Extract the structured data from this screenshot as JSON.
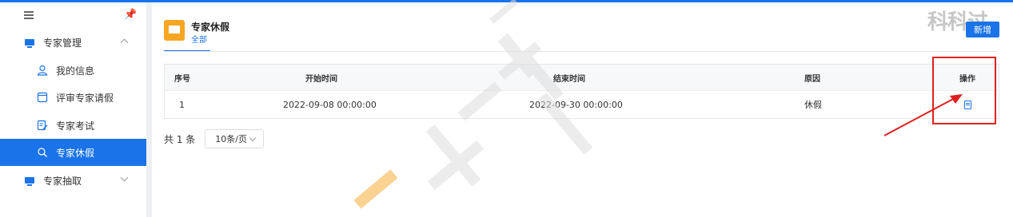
{
  "sidebar": {
    "items": [
      {
        "label": "专家管理",
        "icon": "monitor-icon",
        "expanded": true
      },
      {
        "label": "我的信息",
        "icon": "user-icon"
      },
      {
        "label": "评审专家请假",
        "icon": "window-icon"
      },
      {
        "label": "专家考试",
        "icon": "edit-document-icon"
      },
      {
        "label": "专家休假",
        "icon": "search-user-icon",
        "active": true
      },
      {
        "label": "专家抽取",
        "icon": "monitor-icon",
        "expanded": false
      }
    ]
  },
  "header": {
    "title": "专家休假",
    "subtitle": "全部",
    "new_button": "新增",
    "watermark": "科科过"
  },
  "table": {
    "columns": [
      "序号",
      "开始时间",
      "结束时间",
      "原因",
      "操作"
    ],
    "rows": [
      {
        "index": "1",
        "start": "2022-09-08 00:00:00",
        "end": "2022-09-30 00:00:00",
        "reason": "休假",
        "action": "document-icon"
      }
    ]
  },
  "pager": {
    "total": "共 1 条",
    "page_size": "10条/页"
  },
  "colors": {
    "accent": "#1a73e8",
    "highlight": "#e02020",
    "header_icon": "#f5a623"
  }
}
